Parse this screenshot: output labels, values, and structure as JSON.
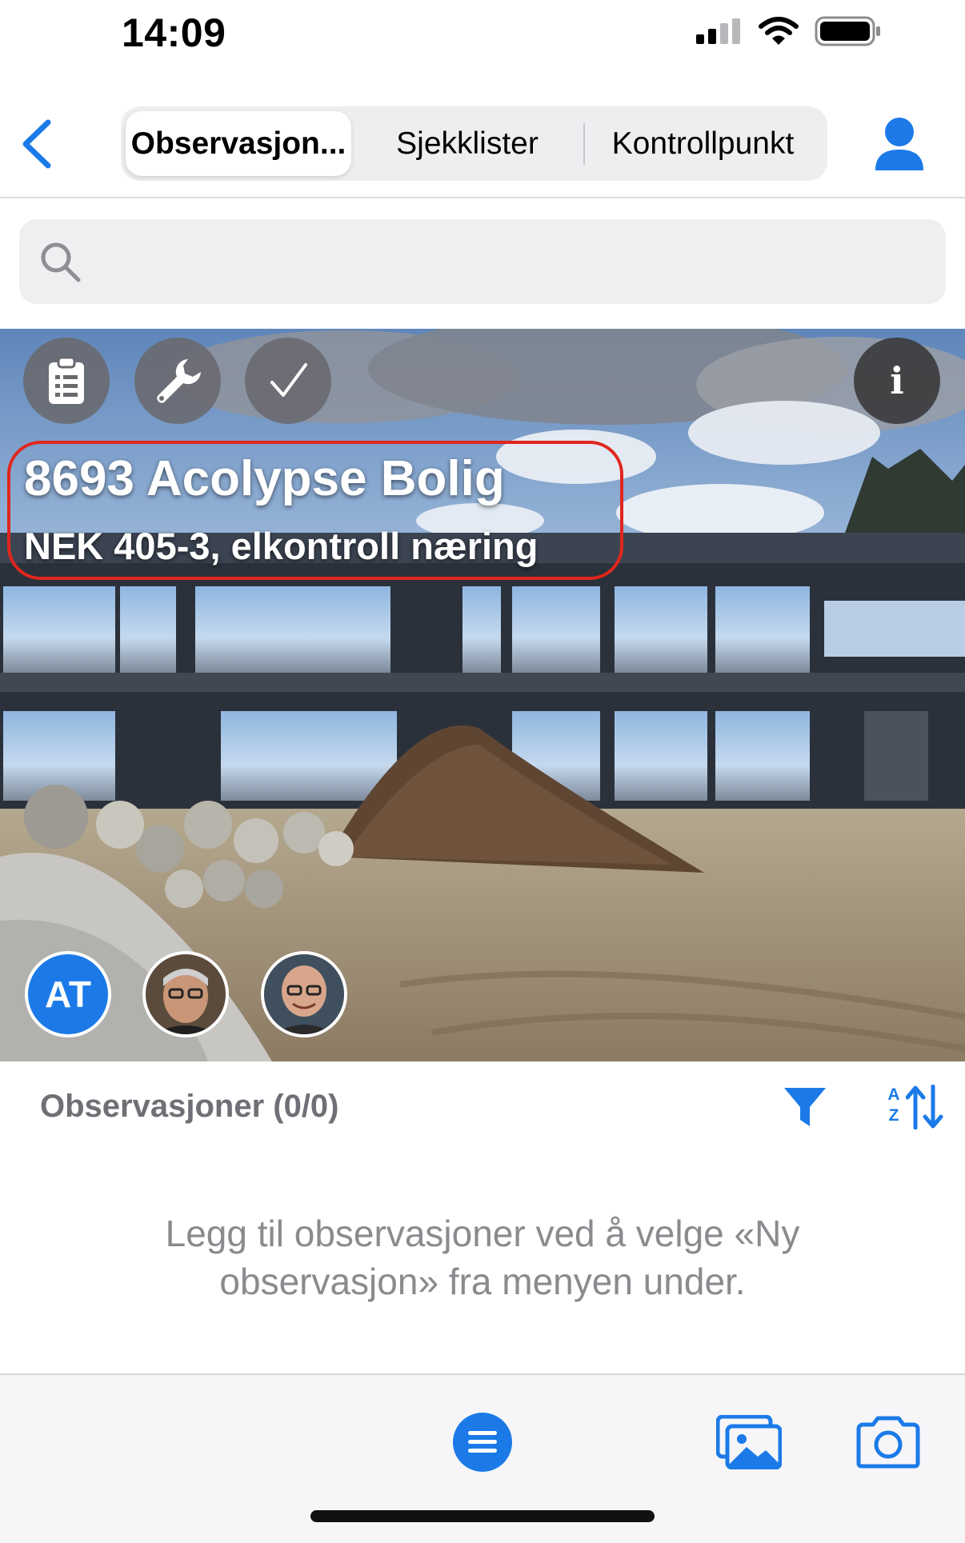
{
  "status_bar": {
    "time": "14:09",
    "icons": [
      "signal-icon",
      "wifi-icon",
      "battery-icon"
    ]
  },
  "nav": {
    "back_icon": "chevron-left-icon",
    "tabs": [
      {
        "label": "Observasjon...",
        "active": true
      },
      {
        "label": "Sjekklister",
        "active": false
      },
      {
        "label": "Kontrollpunkt",
        "active": false
      }
    ],
    "user_icon": "person-icon"
  },
  "search": {
    "placeholder": "",
    "icon": "search-icon"
  },
  "project": {
    "title": "8693 Acolypse Bolig",
    "subtitle": "NEK 405-3, elkontroll næring",
    "action_icons": [
      "clipboard-icon",
      "wrench-icon",
      "checkmark-icon",
      "info-icon"
    ],
    "info_glyph": "i",
    "members": [
      {
        "initials": "AT"
      },
      {
        "initials": ""
      },
      {
        "initials": ""
      }
    ]
  },
  "observations": {
    "header": "Observasjoner (0/0)",
    "empty_message": "Legg til observasjoner ved å velge «Ny observasjon» fra menyen under.",
    "sort_letters": "A Z"
  },
  "toolbar": {
    "icons": [
      "menu-icon",
      "gallery-icon",
      "camera-icon"
    ]
  },
  "colors": {
    "accent": "#1b7ae8",
    "highlight_border": "#e0261d",
    "muted_text": "#8a8a8f"
  }
}
